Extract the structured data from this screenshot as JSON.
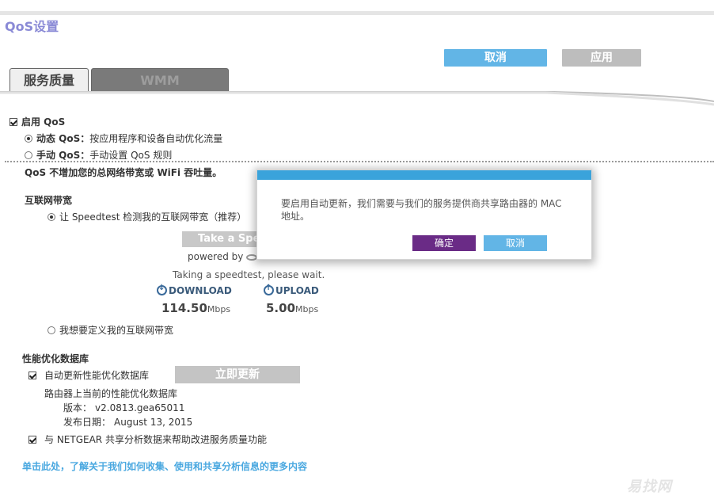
{
  "page": {
    "title": "QoS设置",
    "cancel_label": "取消",
    "apply_label": "应用"
  },
  "tabs": [
    {
      "label": "服务质量",
      "active": true
    },
    {
      "label": "WMM",
      "active": false
    }
  ],
  "qos": {
    "enable_label": "启用 QoS",
    "enable_checked": true,
    "dynamic_title": "动态 QoS：",
    "dynamic_desc": "按应用程序和设备自动优化流量",
    "dynamic_selected": true,
    "manual_title": "手动 QoS：",
    "manual_desc": "手动设置 QoS 规则",
    "manual_selected": false,
    "note": "QoS 不增加您的总网络带宽或 WiFi 吞吐量。"
  },
  "bandwidth": {
    "heading": "互联网带宽",
    "speedtest_option": "让 Speedtest 检测我的互联网带宽（推荐）",
    "speedtest_selected": true,
    "take_button": "Take a Speedtest",
    "powered_by": "powered by",
    "waiting": "Taking a speedtest, please wait.",
    "download_label": "DOWNLOAD",
    "download_value": "114.50",
    "download_unit": "Mbps",
    "upload_label": "UPLOAD",
    "upload_value": "5.00",
    "upload_unit": "Mbps",
    "custom_option": "我想要定义我的互联网带宽",
    "custom_selected": false
  },
  "database": {
    "heading": "性能优化数据库",
    "auto_update_label": "自动更新性能优化数据库",
    "auto_update_checked": true,
    "update_now_button": "立即更新",
    "current_label": "路由器上当前的性能优化数据库",
    "version_label": "版本：",
    "version_value": "v2.0813.gea65011",
    "date_label": "发布日期：",
    "date_value": "August 13, 2015",
    "share_label": "与 NETGEAR 共享分析数据来帮助改进服务质量功能",
    "share_checked": true
  },
  "footer": {
    "link": "单击此处，了解关于我们如何收集、使用和共享分析信息的更多内容",
    "watermark": "易找网"
  },
  "modal": {
    "message": "要启用自动更新，我们需要与我们的服务提供商共享路由器的 MAC 地址。",
    "ok_label": "确定",
    "cancel_label": "取消"
  },
  "colors": {
    "title": "#8a8ad6",
    "cancel_button": "#62b5e6",
    "apply_button": "#bdbdbd",
    "modal_bar": "#3aa3db",
    "modal_ok": "#6a2b86",
    "link": "#4aa8e0"
  },
  "icons": {
    "download": "download-arrow-icon",
    "upload": "upload-arrow-icon",
    "ookla": "ookla-logo-icon"
  }
}
